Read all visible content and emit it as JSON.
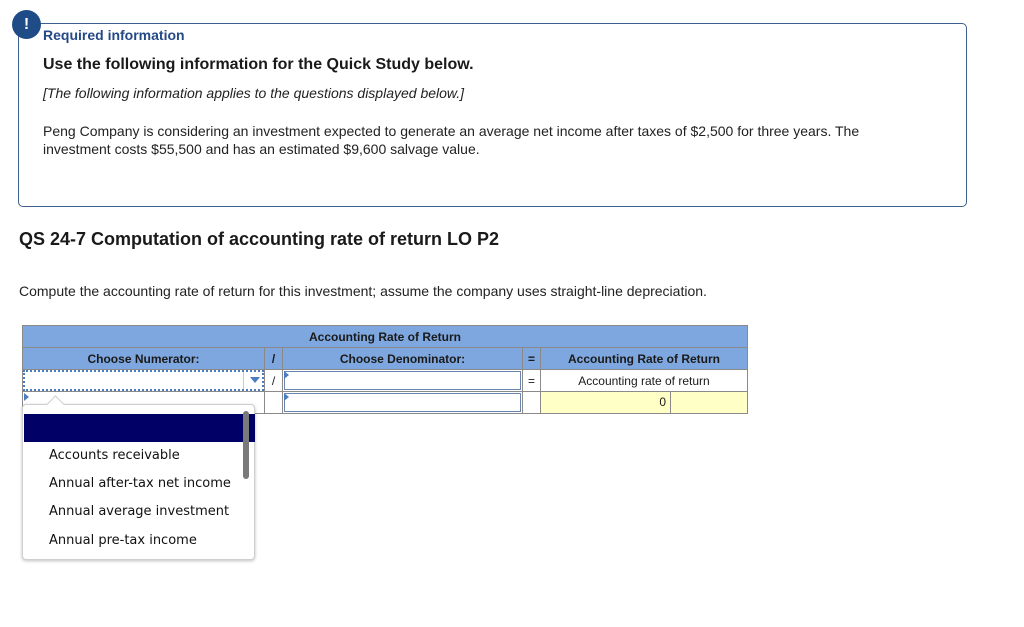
{
  "alert": {
    "icon": "exclamation-icon",
    "symbol": "!"
  },
  "info": {
    "required_title": "Required information",
    "use_title": "Use the following information for the Quick Study below.",
    "applies_note": "[The following information applies to the questions displayed below.]",
    "scenario": "Peng Company is considering an investment expected to generate an average net income after taxes of $2,500 for three years. The investment costs $55,500 and has an estimated $9,600 salvage value."
  },
  "question": {
    "title": "QS 24-7 Computation of accounting rate of return LO P2",
    "instruction": "Compute the accounting rate of return for this investment; assume the company uses straight-line depreciation."
  },
  "table": {
    "title": "Accounting Rate of Return",
    "headers": {
      "numerator": "Choose Numerator:",
      "divide": "/",
      "denominator": "Choose Denominator:",
      "equals": "=",
      "result": "Accounting Rate of Return"
    },
    "rows": [
      {
        "numerator": "",
        "op": "/",
        "denominator": "",
        "eq": "=",
        "result_label": "Accounting rate of return"
      },
      {
        "numerator": "",
        "op": "",
        "denominator": "",
        "eq": "",
        "result_value": "0",
        "result_extra": ""
      }
    ]
  },
  "dropdown": {
    "selected": "",
    "options": [
      "Accounts receivable",
      "Annual after-tax net income",
      "Annual average investment",
      "Annual pre-tax income"
    ]
  },
  "colors": {
    "header_blue": "#7da7de",
    "title_blue": "#244a86",
    "selected_navy": "#000066",
    "result_yellow": "#ffffc6"
  }
}
